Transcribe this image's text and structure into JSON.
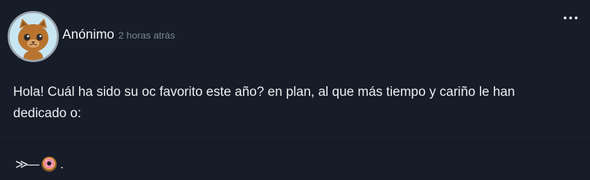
{
  "post": {
    "author": "Anónimo",
    "time": "2 horas atrás",
    "more_label": "Más opciones",
    "content": "Hola! Cuál ha sido su oc favorito este año? en plan, al que más tiempo y cariño le han dedicado o:",
    "footer": {
      "prefix": "≫—",
      "suffix": "."
    }
  },
  "icons": {
    "avatar": "cat-avatar-icon",
    "more": "more-options-icon",
    "donut": "donut-icon"
  },
  "colors": {
    "background": "#161c28",
    "text": "#eceff2",
    "muted": "#7c8794",
    "avatar_bg": "#c8e6f2",
    "cat": "#b8742e"
  }
}
